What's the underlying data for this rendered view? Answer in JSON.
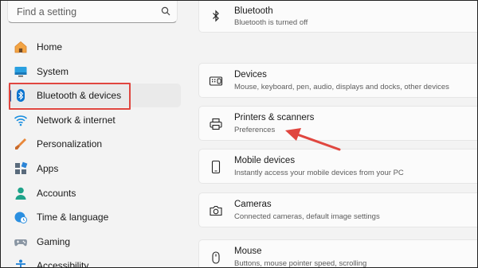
{
  "search": {
    "placeholder": "Find a setting",
    "icon": "search-icon"
  },
  "sidebar": {
    "items": [
      {
        "label": "Home",
        "icon": "home-icon"
      },
      {
        "label": "System",
        "icon": "system-icon"
      },
      {
        "label": "Bluetooth & devices",
        "icon": "bluetooth-icon",
        "selected": true
      },
      {
        "label": "Network & internet",
        "icon": "wifi-icon"
      },
      {
        "label": "Personalization",
        "icon": "brush-icon"
      },
      {
        "label": "Apps",
        "icon": "apps-icon"
      },
      {
        "label": "Accounts",
        "icon": "accounts-icon"
      },
      {
        "label": "Time & language",
        "icon": "globe-clock-icon"
      },
      {
        "label": "Gaming",
        "icon": "gamepad-icon"
      },
      {
        "label": "Accessibility",
        "icon": "accessibility-icon"
      }
    ]
  },
  "main": {
    "cards": [
      {
        "title": "Bluetooth",
        "subtitle": "Bluetooth is turned off",
        "icon": "bluetooth-icon"
      },
      {
        "title": "Devices",
        "subtitle": "Mouse, keyboard, pen, audio, displays and docks, other devices",
        "icon": "keyboard-icon"
      },
      {
        "title": "Printers & scanners",
        "subtitle": "Preferences",
        "icon": "printer-icon"
      },
      {
        "title": "Mobile devices",
        "subtitle": "Instantly access your mobile devices from your PC",
        "icon": "phone-icon"
      },
      {
        "title": "Cameras",
        "subtitle": "Connected cameras, default image settings",
        "icon": "camera-icon"
      },
      {
        "title": "Mouse",
        "subtitle": "Buttons, mouse pointer speed, scrolling",
        "icon": "mouse-icon"
      }
    ]
  },
  "colors": {
    "accent": "#0067c0",
    "annotation": "#e0463f",
    "background": "#f3f3f3"
  }
}
